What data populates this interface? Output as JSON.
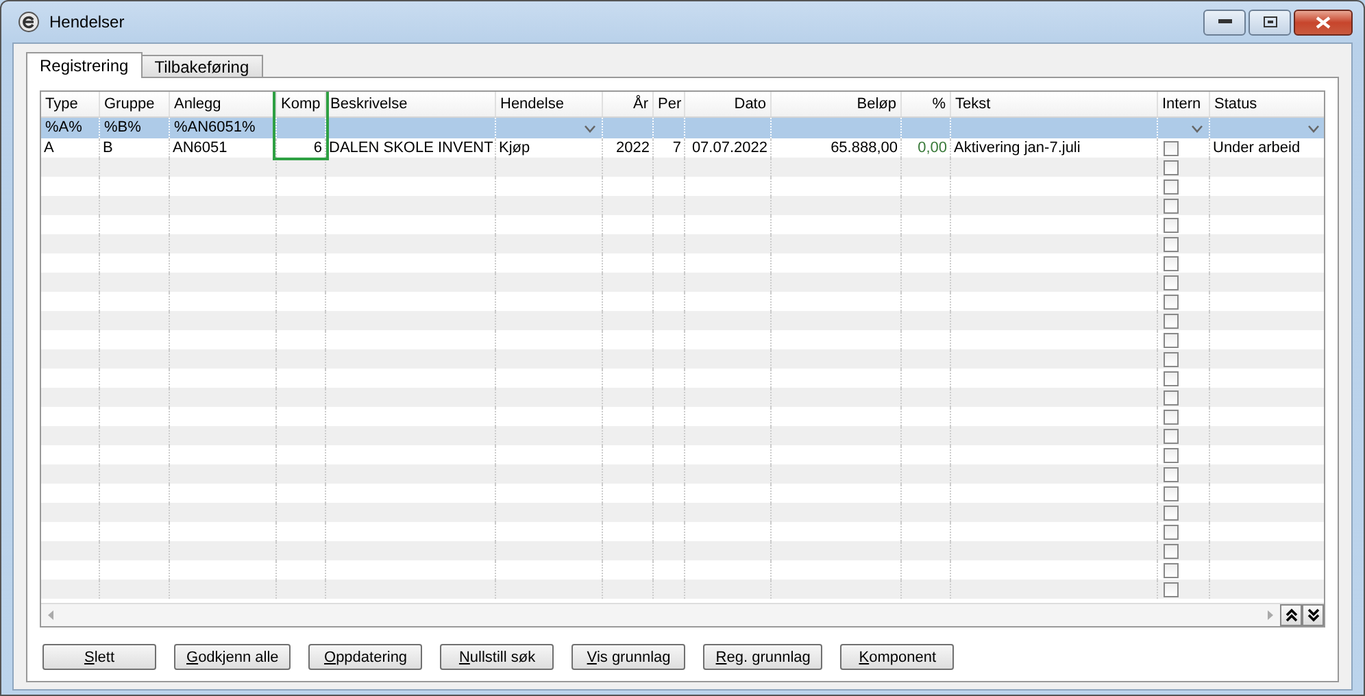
{
  "window": {
    "title": "Hendelser"
  },
  "tabs": [
    {
      "label": "Registrering",
      "selected": true
    },
    {
      "label": "Tilbakeføring",
      "selected": false
    }
  ],
  "table": {
    "columns": [
      {
        "label": "Type"
      },
      {
        "label": "Gruppe"
      },
      {
        "label": "Anlegg"
      },
      {
        "label": "Komp"
      },
      {
        "label": "Beskrivelse"
      },
      {
        "label": "Hendelse"
      },
      {
        "label": "År"
      },
      {
        "label": "Per"
      },
      {
        "label": "Dato"
      },
      {
        "label": "Beløp"
      },
      {
        "label": "%"
      },
      {
        "label": "Tekst"
      },
      {
        "label": "Intern"
      },
      {
        "label": "Status"
      }
    ],
    "filter": [
      "%A%",
      "%B%",
      "%AN6051%"
    ],
    "rows": [
      {
        "cells": [
          "A",
          "B",
          "AN6051",
          "6",
          "DALEN SKOLE INVENT",
          "Kjøp",
          "2022",
          "7",
          "07.07.2022",
          "65.888,00",
          "0,00",
          "Aktivering jan-7.juli",
          "",
          "Under arbeid"
        ],
        "intern": false
      },
      {
        "intern": false
      },
      {
        "intern": false
      },
      {
        "intern": false
      },
      {
        "intern": false
      },
      {
        "intern": false
      },
      {
        "intern": false
      },
      {
        "intern": false
      },
      {
        "intern": false
      },
      {
        "intern": false
      },
      {
        "intern": false
      },
      {
        "intern": false
      },
      {
        "intern": false
      },
      {
        "intern": false
      },
      {
        "intern": false
      },
      {
        "intern": false
      },
      {
        "intern": false
      },
      {
        "intern": false
      },
      {
        "intern": false
      },
      {
        "intern": false
      },
      {
        "intern": false
      },
      {
        "intern": false
      },
      {
        "intern": false
      },
      {
        "intern": false
      }
    ]
  },
  "buttons": [
    "Slett",
    "Godkjenn alle",
    "Oppdatering",
    "Nullstill søk",
    "Vis grunnlag",
    "Reg. grunnlag",
    "Komponent"
  ]
}
